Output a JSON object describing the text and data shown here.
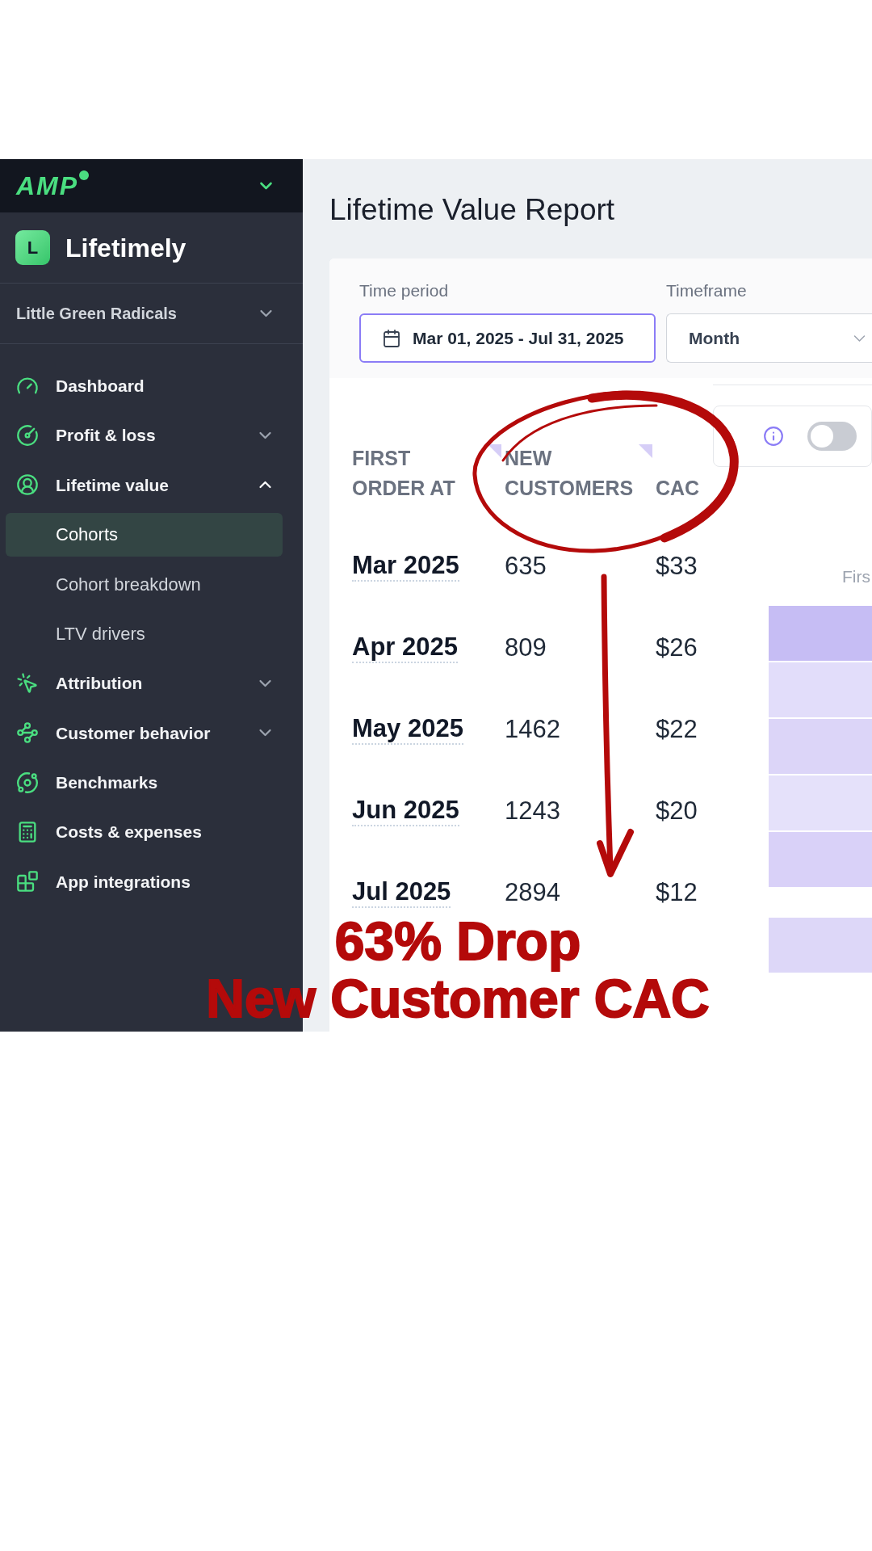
{
  "brand": {
    "logo": "AMP",
    "expanded": false
  },
  "app": {
    "logo_letter": "L",
    "name": "Lifetimely"
  },
  "store": {
    "name": "Little Green Radicals",
    "expanded": false
  },
  "sidebar": {
    "items": [
      {
        "label": "Dashboard",
        "selected": false
      },
      {
        "label": "Profit & loss",
        "selected": false,
        "expanded": false
      },
      {
        "label": "Lifetime value",
        "selected": false,
        "expanded": true,
        "children": [
          {
            "label": "Cohorts",
            "selected": true
          },
          {
            "label": "Cohort breakdown",
            "selected": false
          },
          {
            "label": "LTV drivers",
            "selected": false
          }
        ]
      },
      {
        "label": "Attribution",
        "selected": false,
        "expanded": false
      },
      {
        "label": "Customer behavior",
        "selected": false,
        "expanded": false
      },
      {
        "label": "Benchmarks",
        "selected": false
      },
      {
        "label": "Costs & expenses",
        "selected": false
      },
      {
        "label": "App integrations",
        "selected": false
      }
    ]
  },
  "page": {
    "title": "Lifetime Value Report"
  },
  "filters": [
    {
      "kind": "date-range",
      "label": "Time period",
      "value": "Mar 01, 2025 - Jul 31, 2025",
      "focused": true
    },
    {
      "kind": "select",
      "label": "Timeframe",
      "value": "Month",
      "focused": false
    }
  ],
  "options": {
    "toggle": {
      "on": false
    }
  },
  "table": {
    "columns": [
      {
        "label": "FIRST ORDER AT",
        "sortable": true
      },
      {
        "label": "NEW CUSTOMERS",
        "sortable": true
      },
      {
        "label": "CAC",
        "sortable": false
      }
    ],
    "rows": [
      {
        "cells": [
          "Mar 2025",
          "635",
          "$33"
        ]
      },
      {
        "cells": [
          "Apr 2025",
          "809",
          "$26"
        ]
      },
      {
        "cells": [
          "May 2025",
          "1462",
          "$22"
        ]
      },
      {
        "cells": [
          "Jun 2025",
          "1243",
          "$20"
        ]
      },
      {
        "cells": [
          "Jul 2025",
          "2894",
          "$12"
        ]
      }
    ]
  },
  "heatmap": {
    "header": "Firs",
    "cells": [
      {
        "color": "#c6bdf4"
      },
      {
        "color": "#e2ddfa"
      },
      {
        "color": "#dcd5f8"
      },
      {
        "color": "#e5e1fa"
      },
      {
        "color": "#d9d1f8"
      }
    ],
    "total_cell": {
      "color": "#ddd7f8"
    }
  },
  "annotation": {
    "headline": "63% Drop",
    "subline": "New Customer CAC"
  }
}
